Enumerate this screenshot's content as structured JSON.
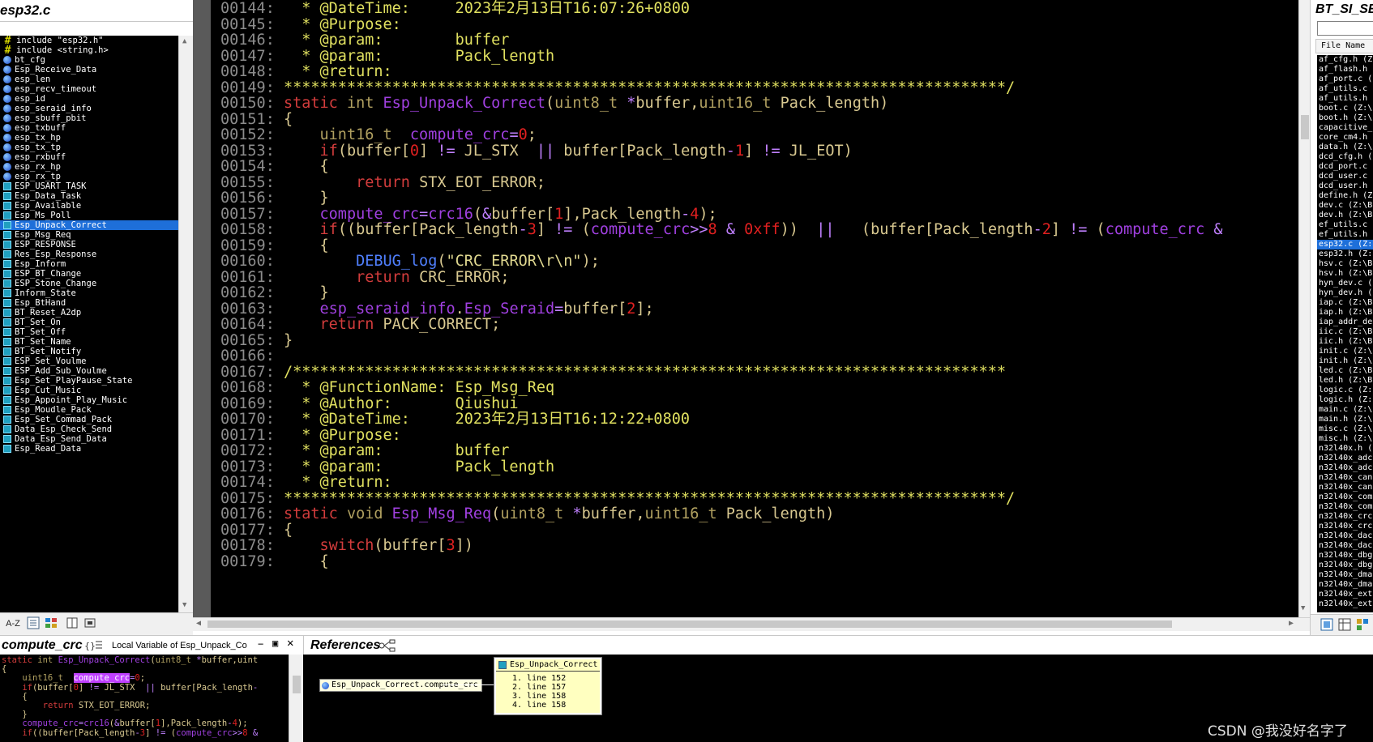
{
  "left_panel": {
    "title": "esp32.c",
    "symbols": [
      {
        "label": "include \"esp32.h\"",
        "icon": "hash-icon"
      },
      {
        "label": "include <string.h>",
        "icon": "hash-icon"
      },
      {
        "label": "bt_cfg",
        "icon": "variable-icon"
      },
      {
        "label": "Esp_Receive_Data",
        "icon": "variable-icon"
      },
      {
        "label": "esp_len",
        "icon": "variable-icon"
      },
      {
        "label": "esp_recv_timeout",
        "icon": "variable-icon"
      },
      {
        "label": "esp_id",
        "icon": "variable-icon"
      },
      {
        "label": "esp_seraid_info",
        "icon": "variable-icon"
      },
      {
        "label": "esp_sbuff_pbit",
        "icon": "variable-icon"
      },
      {
        "label": "esp_txbuff",
        "icon": "variable-icon"
      },
      {
        "label": "esp_tx_hp",
        "icon": "variable-icon"
      },
      {
        "label": "esp_tx_tp",
        "icon": "variable-icon"
      },
      {
        "label": "esp_rxbuff",
        "icon": "variable-icon"
      },
      {
        "label": "esp_rx_hp",
        "icon": "variable-icon"
      },
      {
        "label": "esp_rx_tp",
        "icon": "variable-icon"
      },
      {
        "label": "ESP_USART_TASK",
        "icon": "function-icon"
      },
      {
        "label": "Esp_Data_Task",
        "icon": "function-icon"
      },
      {
        "label": "Esp_Available",
        "icon": "function-icon"
      },
      {
        "label": "Esp_Ms_Poll",
        "icon": "function-icon"
      },
      {
        "label": "Esp_Unpack_Correct",
        "icon": "function-icon",
        "selected": true
      },
      {
        "label": "Esp_Msg_Req",
        "icon": "function-icon"
      },
      {
        "label": "ESP_RESPONSE",
        "icon": "function-icon"
      },
      {
        "label": "Res_Esp_Response",
        "icon": "function-icon"
      },
      {
        "label": "Esp_Inform",
        "icon": "function-icon"
      },
      {
        "label": "ESP_BT_Change",
        "icon": "function-icon"
      },
      {
        "label": "ESP_Stone_Change",
        "icon": "function-icon"
      },
      {
        "label": "Inform_State",
        "icon": "function-icon"
      },
      {
        "label": "Esp_BtHand",
        "icon": "function-icon"
      },
      {
        "label": "BT_Reset_A2dp",
        "icon": "function-icon"
      },
      {
        "label": "BT_Set_On",
        "icon": "function-icon"
      },
      {
        "label": "BT_Set_Off",
        "icon": "function-icon"
      },
      {
        "label": "BT_Set_Name",
        "icon": "function-icon"
      },
      {
        "label": "BT_Set_Notify",
        "icon": "function-icon"
      },
      {
        "label": "ESP_Set_Voulme",
        "icon": "function-icon"
      },
      {
        "label": "ESP_Add_Sub_Voulme",
        "icon": "function-icon"
      },
      {
        "label": "Esp_Set_PlayPause_State",
        "icon": "function-icon"
      },
      {
        "label": "Esp_Cut_Music",
        "icon": "function-icon"
      },
      {
        "label": "Esp_Appoint_Play_Music",
        "icon": "function-icon"
      },
      {
        "label": "Esp_Moudle_Pack",
        "icon": "function-icon"
      },
      {
        "label": "Esp_Set_Commad_Pack",
        "icon": "function-icon"
      },
      {
        "label": "Data_Esp_Check_Send",
        "icon": "function-icon"
      },
      {
        "label": "Data_Esp_Send_Data",
        "icon": "function-icon"
      },
      {
        "label": "Esp_Read_Data",
        "icon": "function-icon"
      }
    ],
    "toolbar": {
      "sort_label": "A-Z"
    }
  },
  "editor": {
    "lines": [
      {
        "n": "00144:",
        "code": "   * @DateTime:     2023年2月13日T16:07:26+0800"
      },
      {
        "n": "00145:",
        "code": "   * @Purpose:"
      },
      {
        "n": "00146:",
        "code": "   * @param:        buffer"
      },
      {
        "n": "00147:",
        "code": "   * @param:        Pack_length"
      },
      {
        "n": "00148:",
        "code": "   * @return:"
      },
      {
        "n": "00149:",
        "code": " ********************************************************************************/"
      },
      {
        "n": "00150:",
        "code": " static int Esp_Unpack_Correct(uint8_t *buffer,uint16_t Pack_length)"
      },
      {
        "n": "00151:",
        "code": " {"
      },
      {
        "n": "00152:",
        "code": "     uint16_t  compute_crc=0;"
      },
      {
        "n": "00153:",
        "code": "     if(buffer[0] != JL_STX  || buffer[Pack_length-1] != JL_EOT)"
      },
      {
        "n": "00154:",
        "code": "     {"
      },
      {
        "n": "00155:",
        "code": "         return STX_EOT_ERROR;"
      },
      {
        "n": "00156:",
        "code": "     }"
      },
      {
        "n": "00157:",
        "code": "     compute_crc=crc16(&buffer[1],Pack_length-4);"
      },
      {
        "n": "00158:",
        "code": "     if((buffer[Pack_length-3] != (compute_crc>>8 & 0xff))  ||   (buffer[Pack_length-2] != (compute_crc &"
      },
      {
        "n": "00159:",
        "code": "     {"
      },
      {
        "n": "00160:",
        "code": "         DEBUG_log(\"CRC_ERROR\\r\\n\");"
      },
      {
        "n": "00161:",
        "code": "         return CRC_ERROR;"
      },
      {
        "n": "00162:",
        "code": "     }"
      },
      {
        "n": "00163:",
        "code": "     esp_seraid_info.Esp_Seraid=buffer[2];"
      },
      {
        "n": "00164:",
        "code": "     return PACK_CORRECT;"
      },
      {
        "n": "00165:",
        "code": " }"
      },
      {
        "n": "00166:",
        "code": ""
      },
      {
        "n": "00167:",
        "code": " /*******************************************************************************"
      },
      {
        "n": "00168:",
        "code": "   * @FunctionName: Esp_Msg_Req"
      },
      {
        "n": "00169:",
        "code": "   * @Author:       Qiushui"
      },
      {
        "n": "00170:",
        "code": "   * @DateTime:     2023年2月13日T16:12:22+0800"
      },
      {
        "n": "00171:",
        "code": "   * @Purpose:"
      },
      {
        "n": "00172:",
        "code": "   * @param:        buffer"
      },
      {
        "n": "00173:",
        "code": "   * @param:        Pack_length"
      },
      {
        "n": "00174:",
        "code": "   * @return:"
      },
      {
        "n": "00175:",
        "code": " ********************************************************************************/"
      },
      {
        "n": "00176:",
        "code": " static void Esp_Msg_Req(uint8_t *buffer,uint16_t Pack_length)"
      },
      {
        "n": "00177:",
        "code": " {"
      },
      {
        "n": "00178:",
        "code": "     switch(buffer[3])"
      },
      {
        "n": "00179:",
        "code": "     {"
      }
    ]
  },
  "right_panel": {
    "title": "BT_SI_SE",
    "column_header": "File Name",
    "files": [
      "af_cfg.h (Z:",
      "af_flash.h",
      "af_port.c (",
      "af_utils.c",
      "af_utils.h",
      "boot.c (Z:\\",
      "boot.h (Z:\\",
      "capacitive_",
      "core_cm4.h",
      "data.h (Z:\\",
      "dcd_cfg.h (",
      "dcd_port.c",
      "dcd_user.c",
      "dcd_user.h",
      "define.h (Z",
      "dev.c (Z:\\B",
      "dev.h (Z:\\B",
      "ef_utils.c",
      "ef_utils.h",
      "esp32.c (Z:",
      "esp32.h (Z:",
      "hsv.c (Z:\\B",
      "hsv.h (Z:\\B",
      "hyn_dev.c (",
      "hyn_dev.h (",
      "iap.c (Z:\\B",
      "iap.h (Z:\\B",
      "iap_addr_de",
      "iic.c (Z:\\B",
      "iic.h (Z:\\B",
      "init.c (Z:\\",
      "init.h (Z:\\",
      "led.c (Z:\\B",
      "led.h (Z:\\B",
      "logic.c (Z:",
      "logic.h (Z:",
      "main.c (Z:\\",
      "main.h (Z:\\",
      "misc.c (Z:\\",
      "misc.h (Z:\\",
      "n32l40x.h (",
      "n32l40x_adc",
      "n32l40x_adc",
      "n32l40x_can",
      "n32l40x_can",
      "n32l40x_com",
      "n32l40x_com",
      "n32l40x_crc",
      "n32l40x_crc",
      "n32l40x_dac",
      "n32l40x_dac",
      "n32l40x_dbg",
      "n32l40x_dbg",
      "n32l40x_dma",
      "n32l40x_dma",
      "n32l40x_ext",
      "n32l40x_ext"
    ],
    "selected_file_index": 19
  },
  "context_panel": {
    "title": "compute_crc",
    "subtitle": "Local Variable of Esp_Unpack_Co",
    "lines": [
      "static int Esp_Unpack_Correct(uint8_t *buffer,uint",
      "{",
      "    uint16_t  ",
      "    if(buffer[0] != JL_STX  || buffer[Pack_length-",
      "    {",
      "        return STX_EOT_ERROR;",
      "    }",
      "    compute_crc=crc16(&buffer[1],Pack_length-4);",
      "    if((buffer[Pack_length-3] != (compute_crc>>8 &"
    ],
    "highlight": "compute_crc",
    "highlight_tail": "=0;"
  },
  "references_panel": {
    "title": "References",
    "root_label": "Esp_Unpack_Correct.compute_crc",
    "box_title": "Esp_Unpack_Correct",
    "refs": [
      "1. line 152",
      "2. line 157",
      "3. line 158",
      "4. line 158"
    ]
  },
  "watermark": "CSDN @我没好名字了",
  "colors": {
    "editor_bg": "#000000",
    "selection": "#1e6fd9",
    "comment": "#e0e060",
    "keyword": "#d23c3c",
    "function": "#a040e0"
  }
}
